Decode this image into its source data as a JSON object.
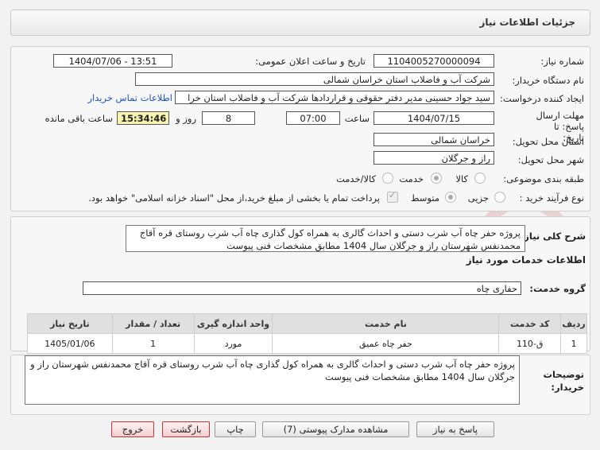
{
  "header": {
    "title": "جزئیات اطلاعات نیاز"
  },
  "fields": {
    "need_number_label": "شماره نیاز:",
    "need_number": "1104005270000094",
    "announce_label": "تاریخ و ساعت اعلان عمومی:",
    "announce_value": "1404/07/06 - 13:51",
    "buyer_label": "نام دستگاه خریدار:",
    "buyer_value": "شرکت آب و فاضلاب استان خراسان شمالی",
    "creator_label": "ایجاد کننده درخواست:",
    "creator_value": "سید جواد حسینی مدیر دفتر حقوقی و قراردادها  شرکت آب و فاضلاب استان خرا",
    "contact_link": "اطلاعات تماس خریدار",
    "deadline_label": "مهلت ارسال پاسخ: تا تاریخ:",
    "deadline_date": "1404/07/15",
    "time_label": "ساعت",
    "deadline_time": "07:00",
    "days_value": "8",
    "days_label": "روز و",
    "remaining_time": "15:34:46",
    "remaining_label": "ساعت باقی مانده",
    "province_label": "استان محل تحویل:",
    "province_value": "خراسان شمالی",
    "city_label": "شهر محل تحویل:",
    "city_value": "راز و جرگلان",
    "category_label": "طبقه بندی موضوعی:",
    "category_options": [
      "کالا",
      "خدمت",
      "کالا/خدمت"
    ],
    "process_label": "نوع فرآیند خرید :",
    "process_options": [
      "جزیی",
      "متوسط"
    ],
    "payment_note": "پرداخت تمام یا بخشی از مبلغ خرید،از محل \"اسناد خزانه اسلامی\" خواهد بود."
  },
  "description": {
    "label": "شرح کلی نیاز:",
    "text": "پروژه حفر چاه آب شرب دستی و احداث گالری به همراه کول گذاری چاه آب شرب روستای قره آقاج محمدنفس شهرستان راز و جرگلان سال 1404 مطابق مشخصات فنی پیوست"
  },
  "services": {
    "section_title": "اطلاعات خدمات مورد نیاز",
    "group_label": "گروه خدمت:",
    "group_value": "حفاری چاه",
    "columns": [
      "ردیف",
      "کد خدمت",
      "نام خدمت",
      "واحد اندازه گیری",
      "تعداد / مقدار",
      "تاریخ نیاز"
    ],
    "rows": [
      [
        "1",
        "ق-110",
        "حفر چاه عمیق",
        "مورد",
        "1",
        "1405/01/06"
      ]
    ]
  },
  "buyer_notes": {
    "label": "توضیحات خریدار:",
    "text": "پروژه حفر چاه آب شرب دستی و احداث گالری به همراه کول گذاری چاه آب شرب روستای قره آقاج محمدنفس شهرستان راز و جرگلان سال 1404 مطابق مشخصات فنی پیوست"
  },
  "buttons": {
    "reply": "پاسخ به نیاز",
    "attachments": "مشاهده مدارک پیوستی (7)",
    "print": "چاپ",
    "back": "بازگشت",
    "exit": "خروج"
  },
  "watermark": {
    "text": "AriaTender.net"
  },
  "colors": {
    "link": "#1a55c9",
    "timer_bg": "#f7f3b0",
    "exit_border": "#cc3333"
  }
}
